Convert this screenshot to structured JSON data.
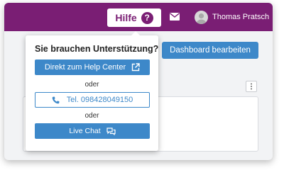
{
  "header": {
    "help_label": "Hilfe",
    "help_icon": "?",
    "mail_icon": "envelope-icon",
    "user_name": "Thomas Pratsch",
    "colors": {
      "brand": "#7a1e74",
      "accent": "#3d88c9"
    }
  },
  "toolbar": {
    "dashboard_button": "Dashboard bearbeiten",
    "more_icon": "⋮"
  },
  "help_popover": {
    "title": "Sie brauchen Unterstützung?",
    "help_center_button": "Direkt zum Help Center",
    "separator_1": "oder",
    "phone_label": "Tel. 098428049150",
    "separator_2": "oder",
    "live_chat_button": "Live Chat"
  }
}
